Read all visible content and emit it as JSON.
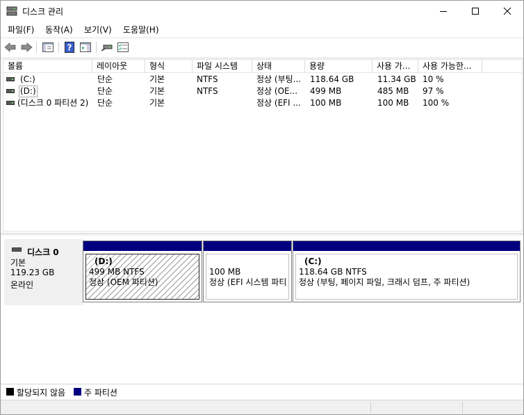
{
  "window": {
    "title": "디스크 관리"
  },
  "menu": [
    "파일(F)",
    "동작(A)",
    "보기(V)",
    "도움말(H)"
  ],
  "toolbar_icons": [
    "back-arrow-icon",
    "forward-arrow-icon",
    "console-tree-icon",
    "help-icon",
    "action-pane-icon",
    "connect-icon",
    "checklist-icon"
  ],
  "volume_list": {
    "headers": [
      "볼륨",
      "레이아웃",
      "형식",
      "파일 시스템",
      "상태",
      "용량",
      "사용 가...",
      "사용 가능한..."
    ],
    "rows": [
      [
        "(C:)",
        "단순",
        "기본",
        "NTFS",
        "정상 (부팅...",
        "118.64 GB",
        "11.34 GB",
        "10 %"
      ],
      [
        "(D:)",
        "단순",
        "기본",
        "NTFS",
        "정상 (OE...",
        "499 MB",
        "485 MB",
        "97 %"
      ],
      [
        "(디스크 0 파티션 2)",
        "단순",
        "기본",
        "",
        "정상 (EFI ...",
        "100 MB",
        "100 MB",
        "100 %"
      ]
    ]
  },
  "disk": {
    "name": "디스크 0",
    "type": "기본",
    "size": "119.23 GB",
    "status": "온라인",
    "partitions": [
      {
        "label": "(D:)",
        "size": "499 MB NTFS",
        "status": "정상 (OEM 파티션)"
      },
      {
        "label": "",
        "size": "100 MB",
        "status": "정상 (EFI 시스템 파티"
      },
      {
        "label": "(C:)",
        "size": "118.64 GB NTFS",
        "status": "정상 (부팅, 페이지 파일, 크래시 덤프, 주 파티션)"
      }
    ]
  },
  "legend": [
    {
      "label": "할당되지 않음",
      "color": "#000000"
    },
    {
      "label": "주 파티션",
      "color": "#00007f"
    }
  ],
  "colors": {
    "primary_partition": "#00007f",
    "unallocated": "#000000"
  }
}
